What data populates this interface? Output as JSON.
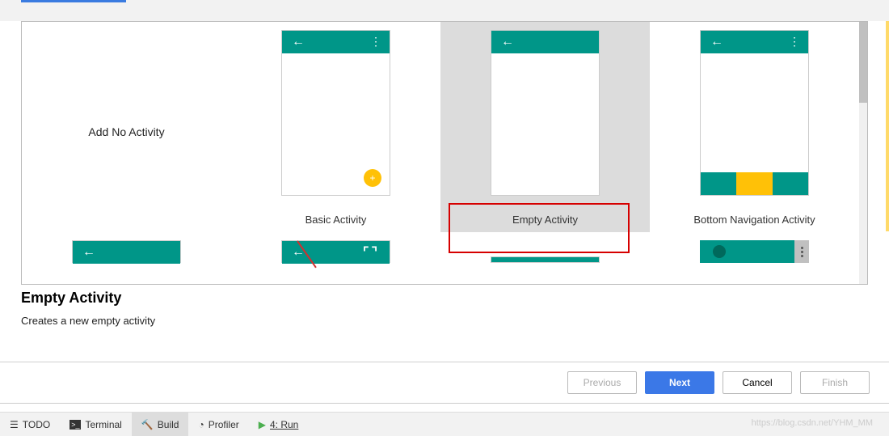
{
  "templates": {
    "row1": [
      {
        "label": "Add No Activity"
      },
      {
        "label": "Basic Activity"
      },
      {
        "label": "Empty Activity"
      },
      {
        "label": "Bottom Navigation Activity"
      }
    ]
  },
  "selected": {
    "title": "Empty Activity",
    "description": "Creates a new empty activity"
  },
  "buttons": {
    "previous": "Previous",
    "next": "Next",
    "cancel": "Cancel",
    "finish": "Finish"
  },
  "statusbar": {
    "todo": "TODO",
    "terminal": "Terminal",
    "build": "Build",
    "profiler": "Profiler",
    "run": "4: Run"
  },
  "watermark": "https://blog.csdn.net/YHM_MM",
  "colors": {
    "teal": "#009688",
    "amber": "#ffc107",
    "primary_blue": "#3b78e7",
    "highlight_red": "#d60000"
  }
}
